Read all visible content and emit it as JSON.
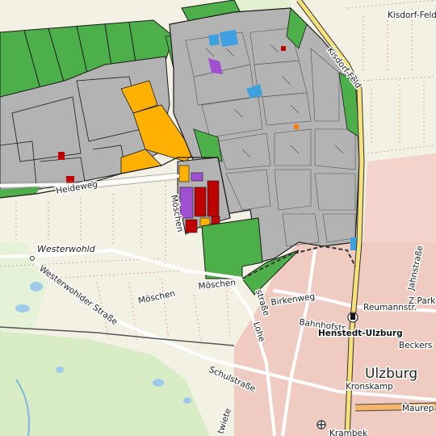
{
  "map": {
    "labels": {
      "kisdorf_feld_top": "Kisdorf-Feld",
      "kisdorf_feld_road": "Kisdorf-Feld",
      "heideweg": "Heideweg",
      "moeschen_vertical": "Möschen",
      "westerwohld": "Westerwohld",
      "westerwohlder_strasse": "Westerwohlder Straße",
      "moeschen_south": "Möschen",
      "moeschen_south2": "Möschen",
      "birkenweg": "Birkenweg",
      "reumannstr": "Reumannstr.",
      "z_park": "Z.Park",
      "jahnstrasse": "Jahnstraße",
      "bahnhofstr": "Bahnhofstr.",
      "henstedt_ulzburg": "Henstedt-Ulzburg",
      "beckers": "Beckers",
      "lohe": "Lohe",
      "strasse_vertical": "straße",
      "schulstrasse": "Schulstraße",
      "ulzburg": "Ulzburg",
      "kronskamp": "Kronskamp",
      "maurep": "Maurep",
      "kampweg": "Krambek",
      "hoheweg": "twiete"
    },
    "colors": {
      "background": "#f2efe6",
      "farmland": "#f7f3e2",
      "green_area": "#4daf4a",
      "industrial_gray": "#b0b0b0",
      "commercial_orange": "#ffb000",
      "residential_red": "#c00000",
      "special_purple": "#a050d0",
      "water_blue": "#3fa0e0",
      "residential_pink": "#f0c8c0",
      "road_yellow": "#f7e27a",
      "road_orange": "#f4b56b"
    },
    "icons": [
      "train-station-icon",
      "bus-stop-icon"
    ]
  }
}
